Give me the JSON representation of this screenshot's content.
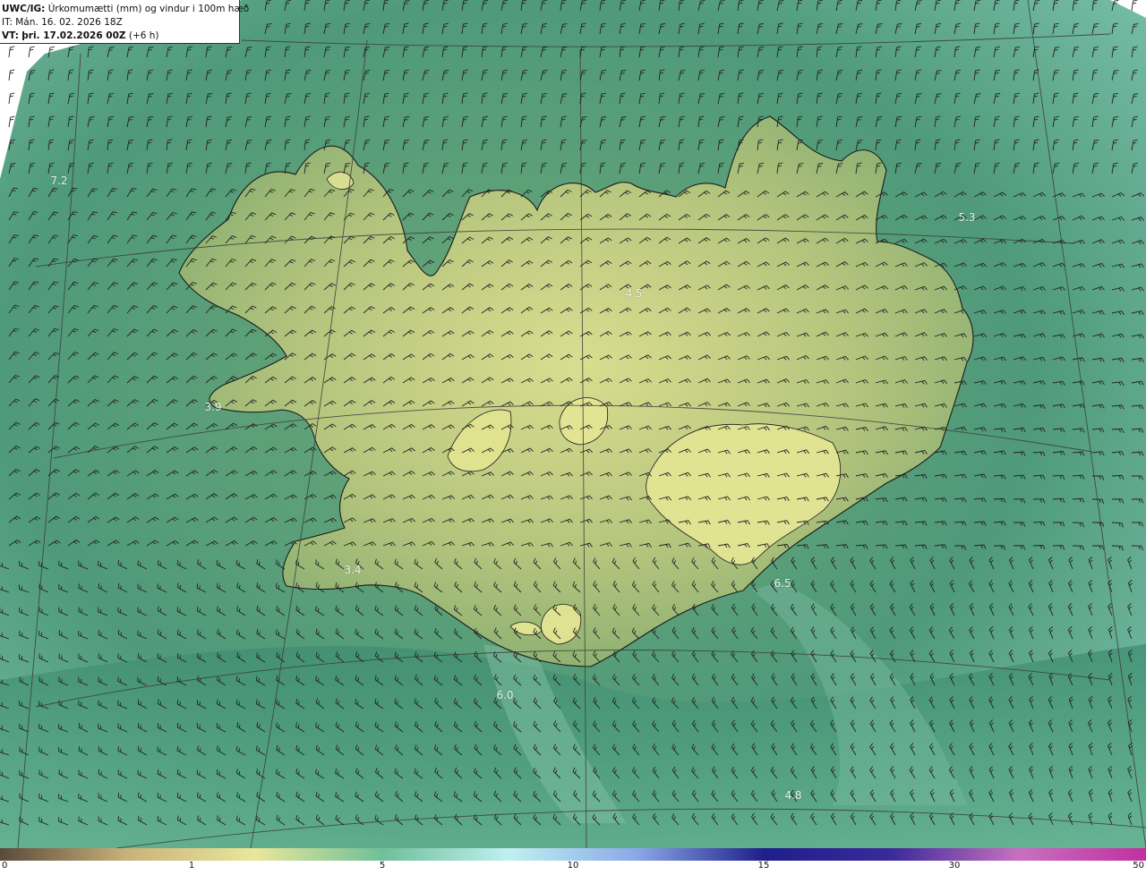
{
  "header": {
    "product_code": "UWC/IG:",
    "product_title": "Úrkomumætti (mm) og vindur i 100m hæð",
    "it_label": "IT:",
    "it_value": "Mán. 16. 02. 2026 18Z",
    "vt_label": "VT:",
    "vt_value": "þri. 17.02.2026 00Z",
    "vt_offset": "(+6 h)"
  },
  "colorbar": {
    "ticks": [
      {
        "label": "0",
        "value": 0
      },
      {
        "label": "1",
        "value": 1
      },
      {
        "label": "5",
        "value": 5
      },
      {
        "label": "10",
        "value": 10
      },
      {
        "label": "15",
        "value": 15
      },
      {
        "label": "30",
        "value": 30
      },
      {
        "label": "50",
        "value": 50
      }
    ],
    "colors": [
      "#5a4a3a",
      "#c9b27a",
      "#e9e79a",
      "#6fbf9a",
      "#bff0f0",
      "#8aa8e8",
      "#1f1f8a",
      "#3a2a9a",
      "#c870c0",
      "#c030a0"
    ]
  },
  "map_values": [
    {
      "label": "7.2",
      "id": "value-west"
    },
    {
      "label": "5.3",
      "id": "value-northeast"
    },
    {
      "label": "4.5",
      "id": "value-north-central"
    },
    {
      "label": "3.9",
      "id": "value-westfjord-south"
    },
    {
      "label": "3.4",
      "id": "value-reykjanes"
    },
    {
      "label": "6.5",
      "id": "value-southeast"
    },
    {
      "label": "6.0",
      "id": "value-south-sea"
    },
    {
      "label": "4.8",
      "id": "value-south-far"
    }
  ],
  "colors": {
    "sea_dark": "#3f8a70",
    "sea_light": "#8fcfb8",
    "land_low": "#7aaa6e",
    "land_high": "#d7dc8e",
    "coast": "#1a1a1a",
    "grid": "#3a3a3a"
  }
}
